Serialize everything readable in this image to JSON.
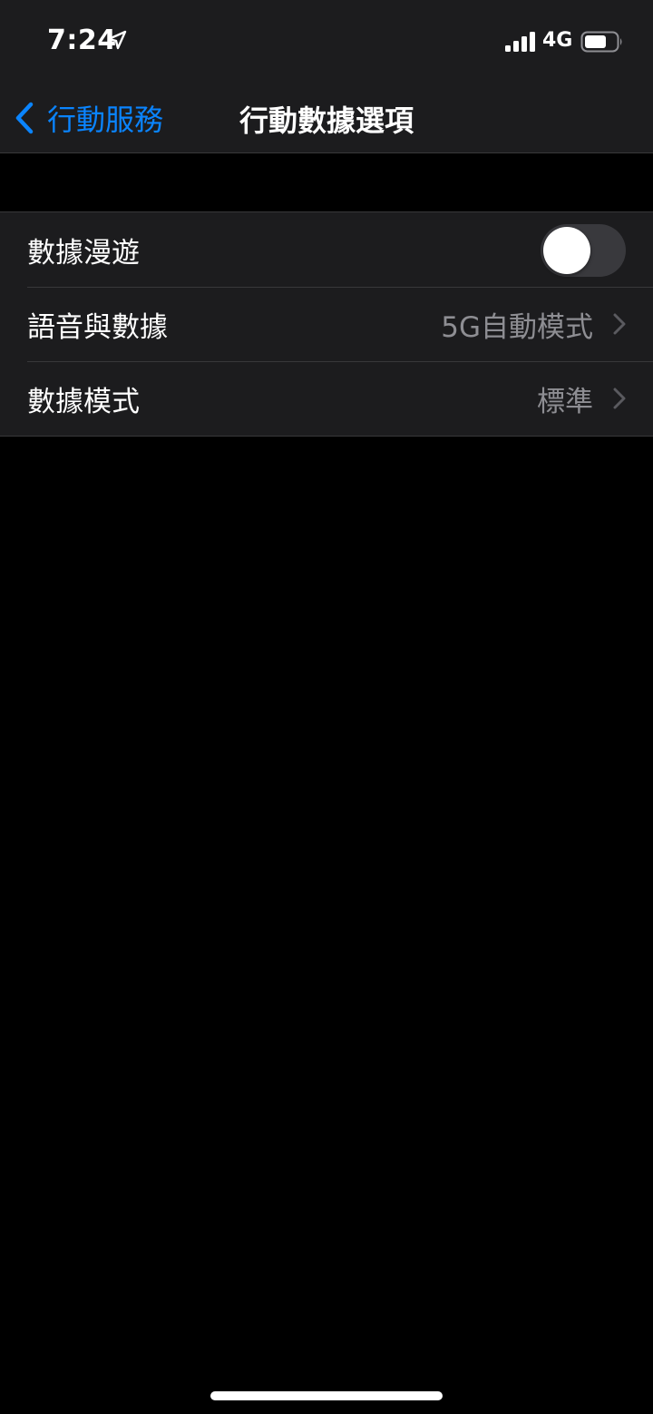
{
  "status_bar": {
    "time": "7:24",
    "network": "4G",
    "location_icon": "location-arrow-icon",
    "signal_icon": "cellular-signal-icon",
    "battery_icon": "battery-icon"
  },
  "nav": {
    "back_label": "行動服務",
    "title": "行動數據選項",
    "back_icon": "chevron-left-icon"
  },
  "rows": [
    {
      "label": "數據漫遊",
      "type": "toggle",
      "on": false
    },
    {
      "label": "語音與數據",
      "value": "5G自動模式",
      "type": "disclosure"
    },
    {
      "label": "數據模式",
      "value": "標準",
      "type": "disclosure"
    }
  ],
  "colors": {
    "background": "#000000",
    "bar_background": "#1c1c1e",
    "accent": "#0a84ff",
    "secondary_text": "#8e8e93",
    "separator": "#38383a",
    "toggle_off": "#39393d"
  }
}
